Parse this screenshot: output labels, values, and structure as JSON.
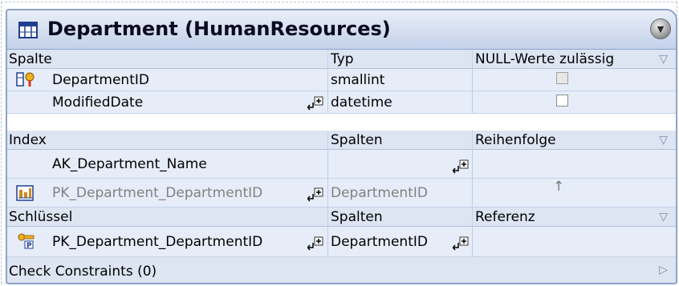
{
  "table": {
    "title": "Department (HumanResources)",
    "icon": "table-icon",
    "collapse_icon": "collapse-circle-icon"
  },
  "columns_section": {
    "headers": [
      "Spalte",
      "Typ",
      "NULL-Werte zulässig"
    ],
    "rows": [
      {
        "name": "DepartmentID",
        "type": "smallint",
        "nullable": false,
        "icon": "primary-key-column-icon"
      },
      {
        "name": "ModifiedDate",
        "type": "datetime",
        "nullable": false
      }
    ]
  },
  "index_section": {
    "headers": [
      "Index",
      "Spalten",
      "Reihenfolge"
    ],
    "rows": [
      {
        "name": "AK_Department_Name",
        "columns": "",
        "order": ""
      },
      {
        "name": "PK_Department_DepartmentID",
        "columns": "DepartmentID",
        "order": "↑",
        "icon": "index-icon"
      }
    ]
  },
  "keys_section": {
    "headers": [
      "Schlüssel",
      "Spalten",
      "Referenz"
    ],
    "rows": [
      {
        "name": "PK_Department_DepartmentID",
        "columns": "DepartmentID",
        "reference": "",
        "icon": "primary-key-icon"
      }
    ]
  },
  "check_constraints": {
    "label": "Check Constraints (0)"
  },
  "colors": {
    "header_bg": "#dde5f3",
    "row_bg": "#e6edf9",
    "border": "#8ea2c8"
  }
}
